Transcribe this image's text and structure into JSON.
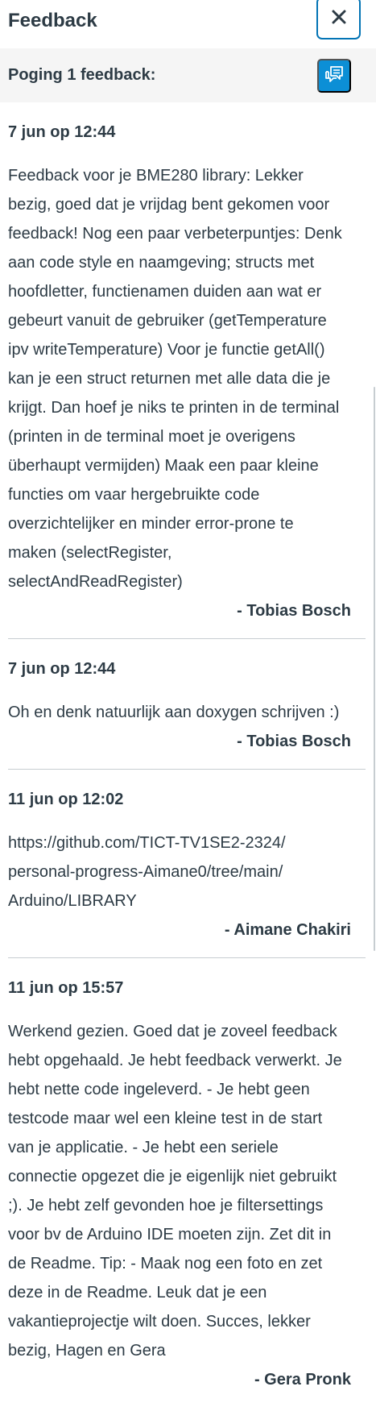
{
  "header": {
    "title": "Feedback",
    "close_label": "×"
  },
  "attempt": {
    "title": "Poging 1 feedback:"
  },
  "comments": [
    {
      "date": "7 jun op 12:44",
      "text": "Feedback voor je BME280 library: Lekker bezig, goed dat je vrijdag bent gekomen voor feedback! Nog een paar verbeterpuntjes: Denk aan code style en naamgeving; structs met hoofdletter, functienamen duiden aan wat er gebeurt vanuit de gebruiker (getTemperature ipv writeTemperature) Voor je functie getAll() kan je een struct returnen met alle data die je krijgt. Dan hoef je niks te printen in de terminal (printen in de terminal moet je overigens überhaupt vermijden) Maak een paar kleine functies om vaar hergebruikte code overzichtelijker en minder error-prone te maken (selectRegister, selectAndReadRegister)",
      "author": "- Tobias Bosch"
    },
    {
      "date": "7 jun op 12:44",
      "text": "Oh en denk natuurlijk aan doxygen schrijven :)",
      "author": "- Tobias Bosch"
    },
    {
      "date": "11 jun op 12:02",
      "text": "https://github.com/TICT-TV1SE2-2324/ personal-progress-Aimane0/tree/main/ Arduino/LIBRARY",
      "author": "- Aimane Chakiri"
    },
    {
      "date": "11 jun op 15:57",
      "text": "Werkend gezien. Goed dat je zoveel feedback hebt opgehaald. Je hebt feedback verwerkt. Je hebt nette code ingeleverd. - Je hebt geen testcode maar wel een kleine test in de start van je applicatie. - Je hebt een seriele connectie opgezet die je eigenlijk niet gebruikt ;). Je hebt zelf gevonden hoe je filtersettings voor bv de Arduino IDE moeten zijn. Zet dit in de Readme. Tip: - Maak nog een foto en zet deze in de Readme. Leuk dat je een vakantieprojectje wilt doen. Succes, lekker bezig, Hagen en Gera",
      "author": "- Gera Pronk"
    }
  ],
  "colors": {
    "text": "#2d3b45",
    "accent_border": "#0374b5",
    "comment_button_bg": "#0c8fd6",
    "attempt_bar_bg": "#f5f5f5",
    "divider": "#c7cdd1"
  },
  "icons": {
    "close": "close-icon",
    "comment": "comment-bubbles-icon"
  }
}
